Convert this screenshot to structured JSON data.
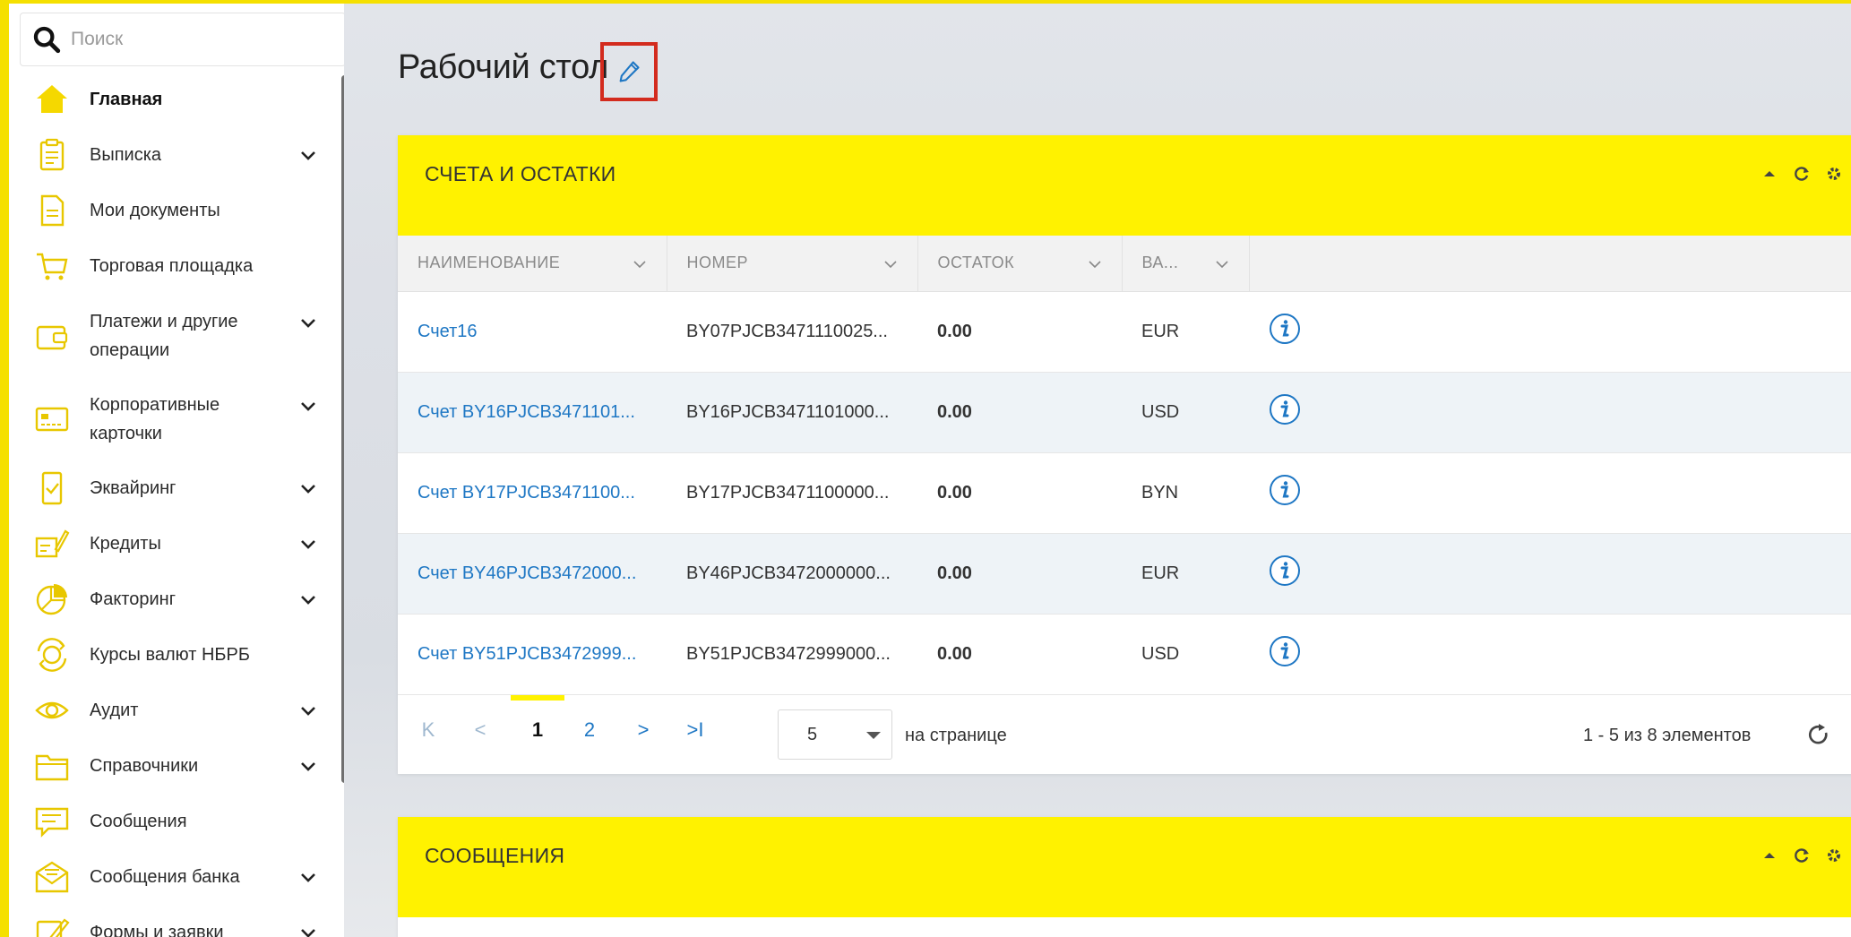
{
  "search": {
    "placeholder": "Поиск"
  },
  "sidebar": {
    "items": [
      {
        "label": "Главная",
        "icon": "home-icon",
        "active": true,
        "expandable": false
      },
      {
        "label": "Выписка",
        "icon": "statement-icon",
        "active": false,
        "expandable": true
      },
      {
        "label": "Мои документы",
        "icon": "document-icon",
        "active": false,
        "expandable": false
      },
      {
        "label": "Торговая площадка",
        "icon": "cart-icon",
        "active": false,
        "expandable": false
      },
      {
        "label": "Платежи и другие операции",
        "icon": "wallet-icon",
        "active": false,
        "expandable": true
      },
      {
        "label": "Корпоративные карточки",
        "icon": "card-icon",
        "active": false,
        "expandable": true
      },
      {
        "label": "Эквайринг",
        "icon": "terminal-icon",
        "active": false,
        "expandable": true
      },
      {
        "label": "Кредиты",
        "icon": "credit-icon",
        "active": false,
        "expandable": true
      },
      {
        "label": "Факторинг",
        "icon": "pie-chart-icon",
        "active": false,
        "expandable": true
      },
      {
        "label": "Курсы валют НБРБ",
        "icon": "currency-exchange-icon",
        "active": false,
        "expandable": false
      },
      {
        "label": "Аудит",
        "icon": "eye-icon",
        "active": false,
        "expandable": true
      },
      {
        "label": "Справочники",
        "icon": "folder-icon",
        "active": false,
        "expandable": true
      },
      {
        "label": "Сообщения",
        "icon": "message-icon",
        "active": false,
        "expandable": false
      },
      {
        "label": "Сообщения банка",
        "icon": "mail-icon",
        "active": false,
        "expandable": true
      },
      {
        "label": "Формы и заявки",
        "icon": "form-icon",
        "active": false,
        "expandable": true
      }
    ]
  },
  "page": {
    "title": "Рабочий стол"
  },
  "accounts_panel": {
    "title": "СЧЕТА И ОСТАТКИ",
    "columns": [
      "НАИМЕНОВАНИЕ",
      "НОМЕР",
      "ОСТАТОК",
      "ВА..."
    ],
    "rows": [
      {
        "name": "Счет16",
        "number": "BY07PJCB3471110025...",
        "balance": "0.00",
        "currency": "EUR"
      },
      {
        "name": "Счет BY16PJCB3471101...",
        "number": "BY16PJCB3471101000...",
        "balance": "0.00",
        "currency": "USD"
      },
      {
        "name": "Счет BY17PJCB3471100...",
        "number": "BY17PJCB3471100000...",
        "balance": "0.00",
        "currency": "BYN"
      },
      {
        "name": "Счет BY46PJCB3472000...",
        "number": "BY46PJCB3472000000...",
        "balance": "0.00",
        "currency": "EUR"
      },
      {
        "name": "Счет BY51PJCB3472999...",
        "number": "BY51PJCB3472999000...",
        "balance": "0.00",
        "currency": "USD"
      }
    ],
    "pager": {
      "first": "K",
      "prev": "<",
      "pages": [
        "1",
        "2"
      ],
      "current_page": "1",
      "next": ">",
      "last": ">I",
      "per_page": "5",
      "per_page_label": "на странице",
      "count_label": "1 - 5 из 8 элементов"
    }
  },
  "messages_panel": {
    "title": "СООБЩЕНИЯ"
  },
  "colors": {
    "accent": "#fff200",
    "link": "#1e77c4",
    "highlight_border": "#d32b1e"
  }
}
